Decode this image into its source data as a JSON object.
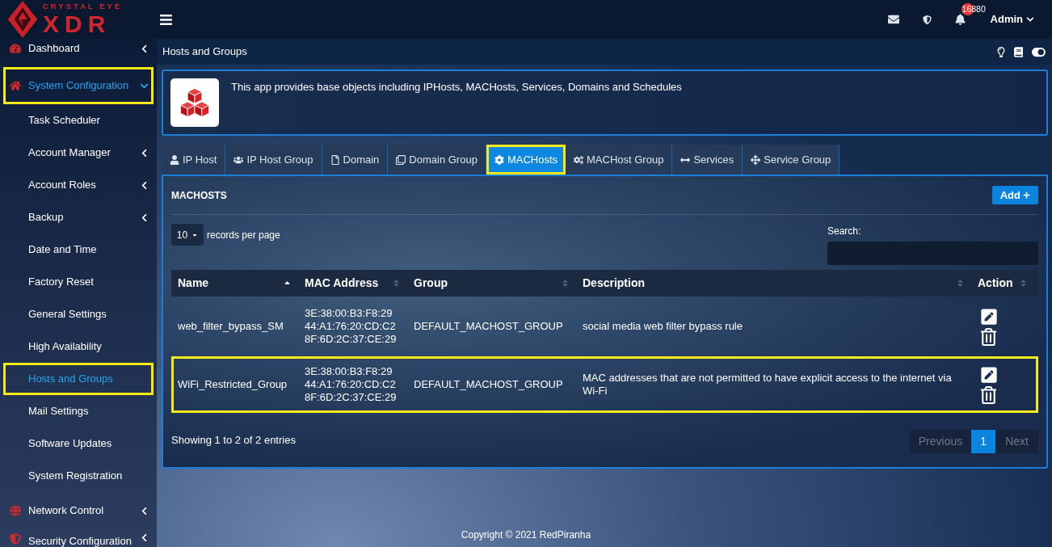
{
  "topbar": {
    "logo": {
      "tagline": "CRYSTAL EYE",
      "name": "XDR"
    },
    "notifications": "16880",
    "user": "Admin"
  },
  "sidebar": {
    "items": [
      {
        "label": "Dashboard",
        "kind": "menu",
        "expanded": false,
        "selected": false,
        "highlighted": false
      },
      {
        "label": "System Configuration",
        "kind": "menu",
        "expanded": true,
        "selected": true,
        "highlighted": true,
        "children": [
          {
            "label": "Task Scheduler",
            "kind": "link",
            "expanded": false,
            "selected": false,
            "highlighted": false
          },
          {
            "label": "Account Manager",
            "kind": "menu",
            "expanded": false,
            "selected": false,
            "highlighted": false
          },
          {
            "label": "Account Roles",
            "kind": "menu",
            "expanded": false,
            "selected": false,
            "highlighted": false
          },
          {
            "label": "Backup",
            "kind": "menu",
            "expanded": false,
            "selected": false,
            "highlighted": false
          },
          {
            "label": "Date and Time",
            "kind": "link",
            "expanded": false,
            "selected": false,
            "highlighted": false
          },
          {
            "label": "Factory Reset",
            "kind": "link",
            "expanded": false,
            "selected": false,
            "highlighted": false
          },
          {
            "label": "General Settings",
            "kind": "link",
            "expanded": false,
            "selected": false,
            "highlighted": false
          },
          {
            "label": "High Availability",
            "kind": "link",
            "expanded": false,
            "selected": false,
            "highlighted": false
          },
          {
            "label": "Hosts and Groups",
            "kind": "link",
            "expanded": false,
            "selected": true,
            "highlighted": true
          },
          {
            "label": "Mail Settings",
            "kind": "link",
            "expanded": false,
            "selected": false,
            "highlighted": false
          },
          {
            "label": "Software Updates",
            "kind": "link",
            "expanded": false,
            "selected": false,
            "highlighted": false
          },
          {
            "label": "System Registration",
            "kind": "link",
            "expanded": false,
            "selected": false,
            "highlighted": false
          }
        ]
      },
      {
        "label": "Network Control",
        "kind": "menu",
        "expanded": false,
        "selected": false,
        "highlighted": false
      },
      {
        "label": "Security Configuration",
        "kind": "menu",
        "expanded": false,
        "selected": false,
        "highlighted": false
      }
    ]
  },
  "breadcrumb": {
    "title": "Hosts and Groups"
  },
  "app_info": {
    "description": "This app provides base objects including IPHosts, MACHosts, Services, Domains and Schedules"
  },
  "tabs": [
    {
      "label": "IP Host",
      "selected": false,
      "highlighted": false
    },
    {
      "label": "IP Host Group",
      "selected": false,
      "highlighted": false
    },
    {
      "label": "Domain",
      "selected": false,
      "highlighted": false
    },
    {
      "label": "Domain Group",
      "selected": false,
      "highlighted": false
    },
    {
      "label": "MACHosts",
      "selected": true,
      "highlighted": true
    },
    {
      "label": "MACHost Group",
      "selected": false,
      "highlighted": false
    },
    {
      "label": "Services",
      "selected": false,
      "highlighted": false
    },
    {
      "label": "Service Group",
      "selected": false,
      "highlighted": false
    }
  ],
  "panel": {
    "title": "MACHOSTS",
    "add_button": "Add",
    "page_size": {
      "value": "10",
      "label": "records per page"
    },
    "search": {
      "label": "Search:"
    },
    "table": {
      "columns": [
        {
          "label": "Name",
          "sorted": true
        },
        {
          "label": "MAC Address",
          "sorted": false
        },
        {
          "label": "Group",
          "sorted": false
        },
        {
          "label": "Description",
          "sorted": false
        },
        {
          "label": "Action",
          "sorted": false
        }
      ],
      "rows": [
        {
          "name": "web_filter_bypass_SM",
          "mac_addresses": [
            "3E:38:00:B3:F8:29",
            "44:A1:76:20:CD:C2",
            "8F:6D:2C:37:CE:29"
          ],
          "group": "DEFAULT_MACHOST_GROUP",
          "description": "social media web filter bypass rule",
          "highlighted": false
        },
        {
          "name": "WiFi_Restricted_Group",
          "mac_addresses": [
            "3E:38:00:B3:F8:29",
            "44:A1:76:20:CD:C2",
            "8F:6D:2C:37:CE:29"
          ],
          "group": "DEFAULT_MACHOST_GROUP",
          "description": "MAC addresses that are not permitted to have explicit access to the internet via Wi-Fi",
          "highlighted": true
        }
      ]
    },
    "summary": "Showing 1 to 2 of 2 entries",
    "pagination": [
      {
        "label": "Previous",
        "kind": "previous",
        "selected": false,
        "disabled": true
      },
      {
        "label": "1",
        "kind": "page",
        "selected": true,
        "disabled": false
      },
      {
        "label": "Next",
        "kind": "next",
        "selected": false,
        "disabled": true
      }
    ]
  },
  "footer": {
    "copyright": "Copyright © 2021 RedPiranha"
  }
}
